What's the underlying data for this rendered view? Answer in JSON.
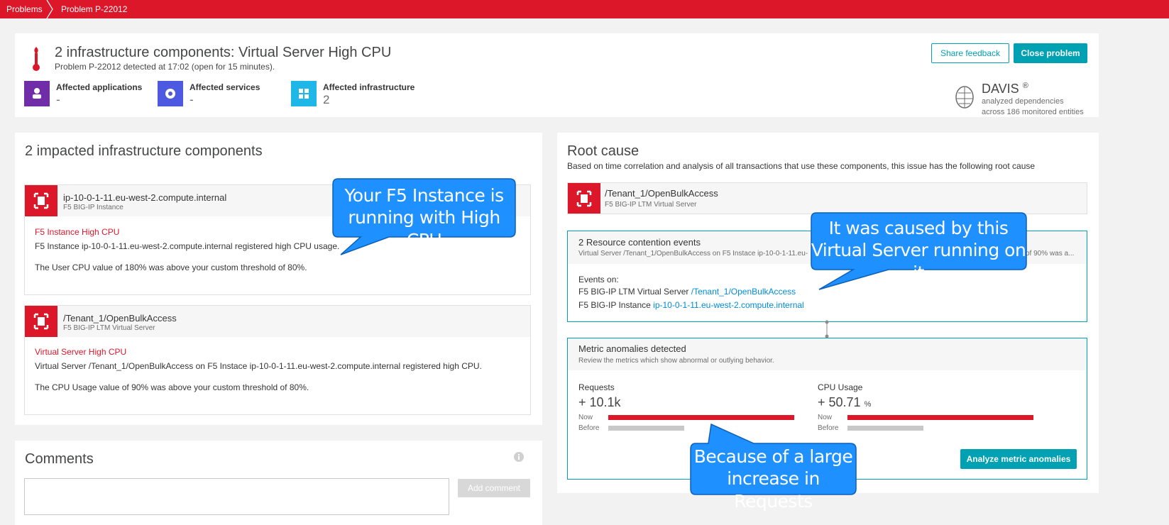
{
  "breadcrumb": {
    "items": [
      "Problems",
      "Problem P-22012"
    ]
  },
  "header": {
    "title": "2 infrastructure components: Virtual Server High CPU",
    "subtitle": "Problem P-22012 detected at 17:02 (open for 15 minutes).",
    "share_feedback": "Share feedback",
    "close_problem": "Close problem",
    "affected": [
      {
        "label": "Affected applications",
        "value": "-",
        "color": "#6f2da8",
        "icon": "user-icon"
      },
      {
        "label": "Affected services",
        "value": "-",
        "color": "#4d59e0",
        "icon": "gear-icon"
      },
      {
        "label": "Affected infrastructure",
        "value": "2",
        "color": "#1fb6e8",
        "icon": "infrastructure-icon"
      }
    ],
    "davis": {
      "name": "DAVIS",
      "mark": "®",
      "line1": "analyzed dependencies",
      "line2": "across 186 monitored entities"
    }
  },
  "impacted": {
    "title": "2 impacted infrastructure components",
    "cards": [
      {
        "name": "ip-10-0-1-11.eu-west-2.compute.internal",
        "type": "F5 BIG-IP Instance",
        "event": "F5 Instance High CPU",
        "line1": "F5 Instance ip-10-0-1-11.eu-west-2.compute.internal registered high CPU usage.",
        "line2": "The User CPU value of 180% was above your custom threshold of 80%."
      },
      {
        "name": "/Tenant_1/OpenBulkAccess",
        "type": "F5 BIG-IP LTM Virtual Server",
        "event": "Virtual Server High CPU",
        "line1": "Virtual Server /Tenant_1/OpenBulkAccess on F5 Instace ip-10-0-1-11.eu-west-2.compute.internal registered high CPU.",
        "line2": "The CPU Usage value of 90% was above your custom threshold of 80%."
      }
    ]
  },
  "comments": {
    "title": "Comments",
    "add_comment": "Add comment"
  },
  "root_cause": {
    "title": "Root cause",
    "description": "Based on time correlation and analysis of all transactions that use these components, this issue has the following root cause",
    "entity_name": "/Tenant_1/OpenBulkAccess",
    "entity_type": "F5 BIG-IP LTM Virtual Server",
    "events_title": "2 Resource contention events",
    "events_sub_left": "Virtual Server /Tenant_1/OpenBulkAccess on F5 Instace ip-10-0-1-11.eu-",
    "events_sub_right": "of 90% was a...",
    "events_on": "Events on:",
    "event1_prefix": "F5 BIG-IP LTM Virtual Server",
    "event1_link": "/Tenant_1/OpenBulkAccess",
    "event2_prefix": "F5 BIG-IP Instance",
    "event2_link": "ip-10-0-1-11.eu-west-2.compute.internal",
    "metrics_title": "Metric anomalies detected",
    "metrics_sub": "Review the metrics which show abnormal or outlying behavior.",
    "metrics": [
      {
        "label": "Requests",
        "value": "+ 10.1k",
        "unit": "",
        "now_label": "Now",
        "before_label": "Before",
        "now_fraction": 1.0,
        "before_fraction": 0.41
      },
      {
        "label": "CPU Usage",
        "value": "+ 50.71",
        "unit": "%",
        "now_label": "Now",
        "before_label": "Before",
        "now_fraction": 1.0,
        "before_fraction": 0.41
      }
    ],
    "analyze_button": "Analyze metric anomalies"
  },
  "callouts": {
    "c1_line1": "Your F5 Instance is",
    "c1_line2": "running with High CPU",
    "c2_line1": "It was caused by this",
    "c2_line2": "Virtual Server running on it",
    "c3_line1": "Because of a large",
    "c3_line2": "increase in Requests"
  },
  "colors": {
    "brand_red": "#dc172a",
    "accent_teal": "#00a1b2",
    "callout_blue": "#1e90ff",
    "link_teal": "#008cdb"
  }
}
